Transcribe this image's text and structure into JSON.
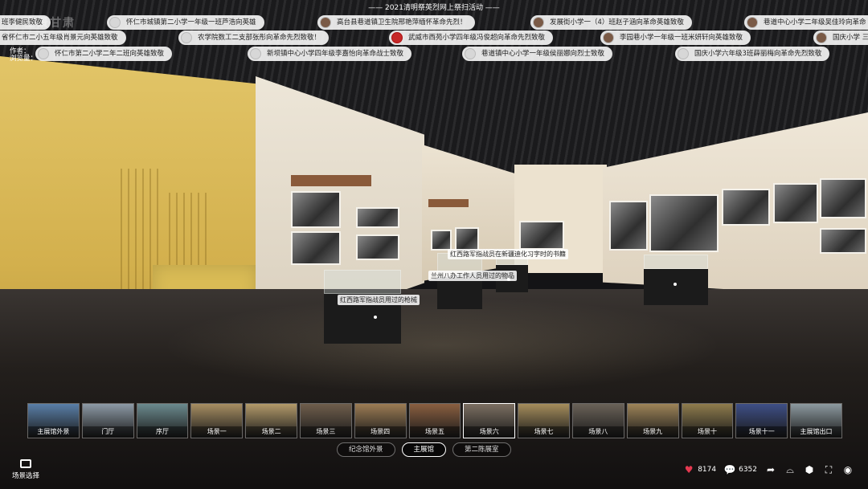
{
  "activity_title": "—— 2021清明祭英烈网上祭扫活动 ——",
  "logo_text": "全景甘肃",
  "author_label": "作者：",
  "views_label": "浏览量：",
  "messages_row1": [
    {
      "text": "班李健民致敬",
      "avatar": "blank"
    },
    {
      "text": "怀仁市城镇第二小学一年级一班芦浩向英雄",
      "avatar": "blank"
    },
    {
      "text": "高台县巷道镇卫生院邢艳萍缅怀革命先烈！",
      "avatar": "photo"
    },
    {
      "text": "发展街小学一（4）班赵子涵向革命英雄致敬",
      "avatar": "photo"
    },
    {
      "text": "巷道中心小学二年级吴佳玲向革命",
      "avatar": "photo"
    }
  ],
  "messages_row2": [
    {
      "text": "省怀仁市二小五年级肖景元向英雄致敬",
      "avatar": "none"
    },
    {
      "text": "农学院数工二支部张彤向革命先烈致敬！",
      "avatar": "blank"
    },
    {
      "text": "武威市西苑小学四年级冯俊超向革命先烈致敬",
      "avatar": "red"
    },
    {
      "text": "李园巷小学一年级一班米妍轩向英雄致敬",
      "avatar": "photo"
    },
    {
      "text": "国庆小学 三",
      "avatar": "photo"
    }
  ],
  "messages_row3": [
    {
      "text": "怀仁市第二小学二年二班向英雄致敬",
      "avatar": "blank"
    },
    {
      "text": "新坝镇中心小学四年级李嘉怡向革命战士致敬",
      "avatar": "blank"
    },
    {
      "text": "巷道镇中心小学一年级侯丽娜向烈士致敬",
      "avatar": "blank"
    },
    {
      "text": "国庆小学六年级3班薛丽梅向革命先烈致敬",
      "avatar": "blank"
    }
  ],
  "exhibit_labels": {
    "label1": "红西路军指战员用过的枪械",
    "label2": "兰州八办工作人员用过的物品",
    "label3": "红西路军指战员在新疆迪化习字时的书籍"
  },
  "scenes": [
    {
      "label": "主展馆外景",
      "tone": "#5a7fa8"
    },
    {
      "label": "门厅",
      "tone": "#8d9aa6"
    },
    {
      "label": "序厅",
      "tone": "#6b8a8e"
    },
    {
      "label": "场景一",
      "tone": "#a78e62"
    },
    {
      "label": "场景二",
      "tone": "#b39a6a"
    },
    {
      "label": "场景三",
      "tone": "#6f5e4c"
    },
    {
      "label": "场景四",
      "tone": "#9c7c54"
    },
    {
      "label": "场景五",
      "tone": "#8a5f40"
    },
    {
      "label": "场景六",
      "tone": "#7c6f62"
    },
    {
      "label": "场景七",
      "tone": "#a58d5c"
    },
    {
      "label": "场景八",
      "tone": "#6a6258"
    },
    {
      "label": "场景九",
      "tone": "#9e8458"
    },
    {
      "label": "场景十",
      "tone": "#8f7c4d"
    },
    {
      "label": "场景十一",
      "tone": "#3e4f86"
    },
    {
      "label": "主展馆出口",
      "tone": "#8d9aa0"
    }
  ],
  "active_scene_index": 8,
  "tabs": [
    {
      "label": "纪念馆外景",
      "active": false
    },
    {
      "label": "主展馆",
      "active": true
    },
    {
      "label": "第二陈展室",
      "active": false
    }
  ],
  "scene_select_label": "场景选择",
  "likes": "8174",
  "comments": "6352",
  "colors": {
    "heart": "#e53950",
    "accent": "#ffffff"
  }
}
